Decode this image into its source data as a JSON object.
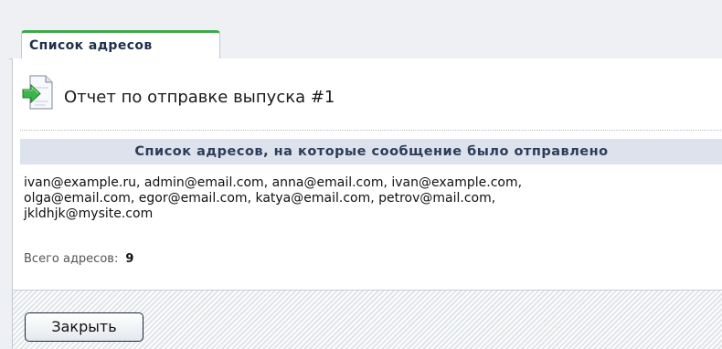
{
  "tabs": [
    {
      "label": "Список адресов",
      "active": true
    }
  ],
  "report": {
    "icon": "document-send-icon",
    "title": "Отчет по отправке выпуска #1"
  },
  "section": {
    "header": "Список адресов, на которые сообщение было отправлено",
    "address_lines": [
      "ivan@example.ru, admin@email.com, anna@email.com, ivan@example.com,",
      "olga@email.com, egor@email.com, katya@email.com, petrov@mail.com,",
      "jkldhjk@mysite.com"
    ],
    "total_label": "Всего адресов:",
    "total_count": "9"
  },
  "footer": {
    "close_label": "Закрыть"
  },
  "colors": {
    "tab_accent": "#3fa84b",
    "section_header_bg": "#dde2ec",
    "section_header_text": "#2c3d58"
  }
}
